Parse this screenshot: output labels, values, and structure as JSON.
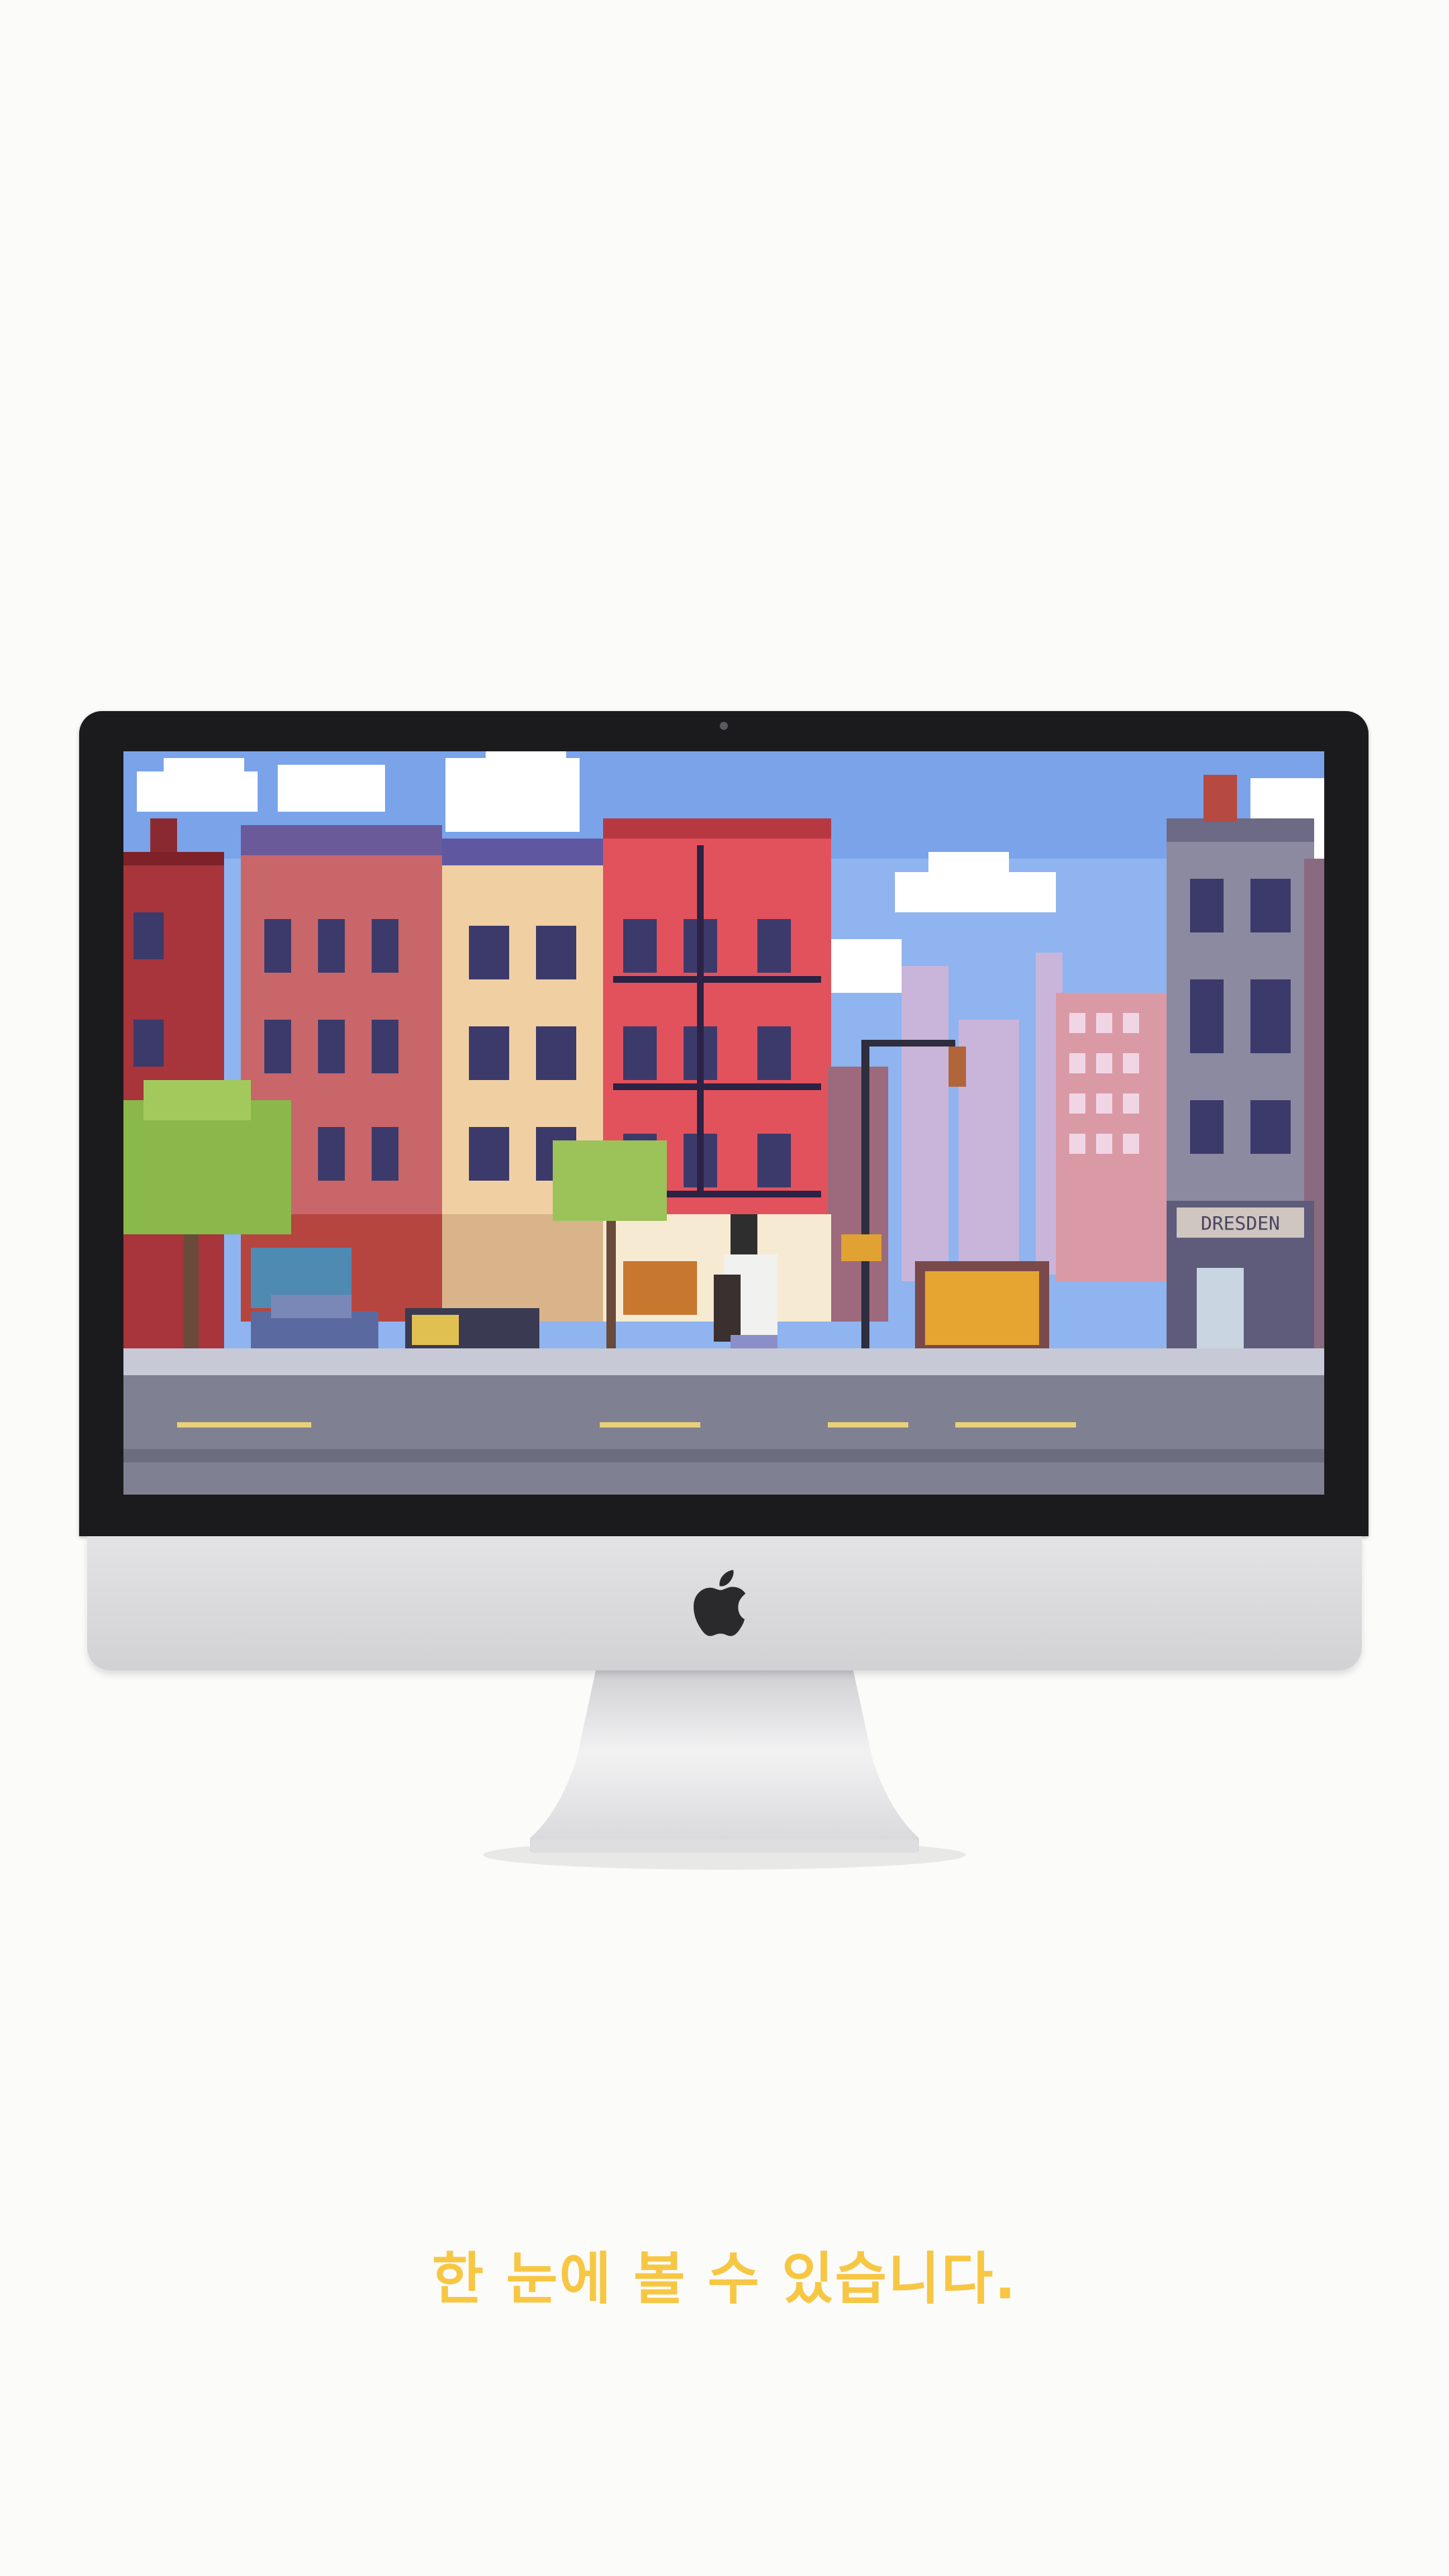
{
  "caption": {
    "text": "한 눈에 볼 수 있습니다."
  },
  "screen": {
    "sign_text": "DRESDEN"
  },
  "colors": {
    "caption": "#f7c744",
    "sky": "#8fb4ef",
    "bezel": "#1b1b1d",
    "chin": "#dcdcdf"
  },
  "icons": [
    "apple-logo-icon",
    "camera-icon"
  ]
}
